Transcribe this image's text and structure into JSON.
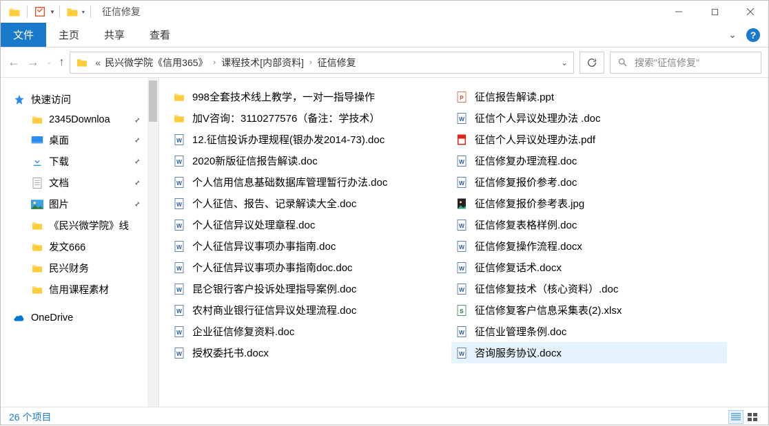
{
  "title_bar": {
    "title": "征信修复"
  },
  "ribbon": {
    "file": "文件",
    "home": "主页",
    "share": "共享",
    "view": "查看"
  },
  "breadcrumb": {
    "parts": [
      "民兴微学院《信用365》",
      "课程技术[内部资料]",
      "征信修复"
    ]
  },
  "search": {
    "placeholder": "搜索\"征信修复\""
  },
  "sidebar": {
    "quick_access": "快速访问",
    "items": [
      {
        "label": "2345Downloa",
        "icon": "folder",
        "pinned": true
      },
      {
        "label": "桌面",
        "icon": "desktop",
        "pinned": true
      },
      {
        "label": "下载",
        "icon": "download",
        "pinned": true
      },
      {
        "label": "文档",
        "icon": "docs",
        "pinned": true
      },
      {
        "label": "图片",
        "icon": "pics",
        "pinned": true
      },
      {
        "label": "《民兴微学院》线",
        "icon": "folder",
        "pinned": false
      },
      {
        "label": "发文666",
        "icon": "folder",
        "pinned": false
      },
      {
        "label": "民兴财务",
        "icon": "folder",
        "pinned": false
      },
      {
        "label": "信用课程素材",
        "icon": "folder",
        "pinned": false
      }
    ],
    "onedrive": "OneDrive"
  },
  "files": {
    "col1": [
      {
        "name": "998全套技术线上教学，一对一指导操作",
        "type": "folder"
      },
      {
        "name": "加V咨询：3110277576（备注：学技术）",
        "type": "folder"
      },
      {
        "name": "12.征信投诉办理规程(银办发2014-73).doc",
        "type": "docx"
      },
      {
        "name": "2020新版征信报告解读.doc",
        "type": "docx"
      },
      {
        "name": "个人信用信息基础数据库管理暂行办法.doc",
        "type": "docx"
      },
      {
        "name": "个人征信、报告、记录解读大全.doc",
        "type": "docx"
      },
      {
        "name": "个人征信异议处理章程.doc",
        "type": "docx"
      },
      {
        "name": "个人征信异议事项办事指南.doc",
        "type": "docx"
      },
      {
        "name": "个人征信异议事项办事指南doc.doc",
        "type": "docx"
      },
      {
        "name": "昆仑银行客户投诉处理指导案例.doc",
        "type": "docx"
      },
      {
        "name": "农村商业银行征信异议处理流程.doc",
        "type": "docx"
      },
      {
        "name": "企业征信修复资料.doc",
        "type": "docx"
      },
      {
        "name": "授权委托书.docx",
        "type": "docx"
      }
    ],
    "col2": [
      {
        "name": "征信报告解读.ppt",
        "type": "ppt"
      },
      {
        "name": "征信个人异议处理办法 .doc",
        "type": "docx"
      },
      {
        "name": "征信个人异议处理办法.pdf",
        "type": "pdf"
      },
      {
        "name": "征信修复办理流程.doc",
        "type": "docx"
      },
      {
        "name": "征信修复报价参考.doc",
        "type": "docx"
      },
      {
        "name": "征信修复报价参考表.jpg",
        "type": "jpg"
      },
      {
        "name": "征信修复表格样例.doc",
        "type": "docx"
      },
      {
        "name": "征信修复操作流程.docx",
        "type": "docx"
      },
      {
        "name": "征信修复话术.docx",
        "type": "docx"
      },
      {
        "name": "征信修复技术（核心资料）.doc",
        "type": "docx"
      },
      {
        "name": "征信修复客户信息采集表(2).xlsx",
        "type": "xlsx"
      },
      {
        "name": "征信业管理条例.doc",
        "type": "docx"
      },
      {
        "name": "咨询服务协议.docx",
        "type": "docx",
        "hovered": true
      }
    ]
  },
  "status": {
    "count": "26 个项目"
  }
}
